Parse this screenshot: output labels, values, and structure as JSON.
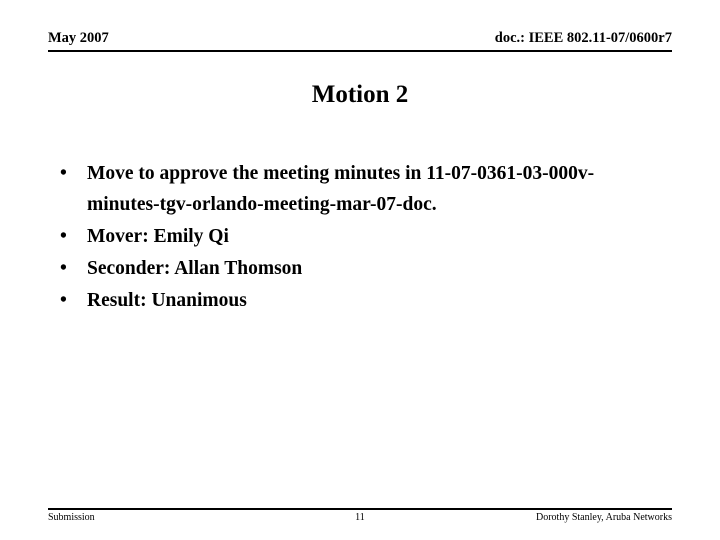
{
  "header": {
    "date": "May 2007",
    "doc": "doc.: IEEE 802.11-07/0600r7"
  },
  "title": "Motion 2",
  "body": {
    "bullet_glyph": "•",
    "bullets": [
      "Move to approve the meeting minutes in 11-07-0361-03-000v-minutes-tgv-orlando-meeting-mar-07-doc.",
      "Mover: Emily Qi",
      "Seconder: Allan Thomson",
      "Result: Unanimous"
    ]
  },
  "footer": {
    "left": "Submission",
    "page_number": "11",
    "right": "Dorothy Stanley, Aruba Networks"
  }
}
